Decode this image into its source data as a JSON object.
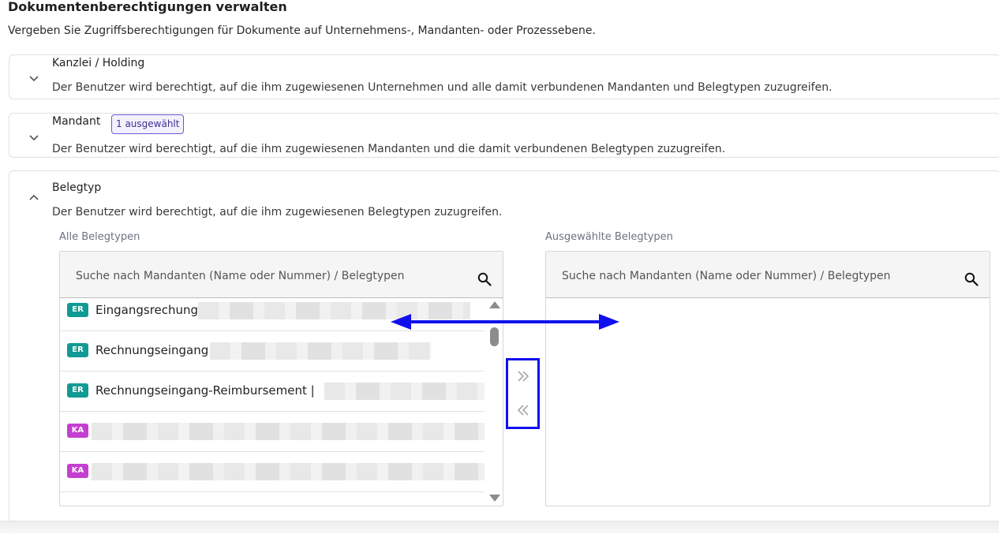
{
  "page": {
    "title": "Dokumentenberechtigungen verwalten",
    "subtitle": "Vergeben Sie Zugriffsberechtigungen für Dokumente auf Unternehmens-, Mandanten- oder Prozessebene."
  },
  "sections": [
    {
      "title": "Kanzlei / Holding",
      "description": "Der Benutzer wird berechtigt, auf die ihm zugewiesenen Unternehmen und alle damit verbundenen Mandanten und Belegtypen zuzugreifen.",
      "expanded": false
    },
    {
      "title": "Mandant",
      "badge": "1 ausgewählt",
      "description": "Der Benutzer wird berechtigt, auf die ihm zugewiesenen Mandanten und die damit verbundenen Belegtypen zuzugreifen.",
      "expanded": false
    },
    {
      "title": "Belegtyp",
      "description": "Der Benutzer wird berechtigt, auf die ihm zugewiesenen Belegtypen zuzugreifen.",
      "expanded": true
    }
  ],
  "belegtyp": {
    "all_label": "Alle Belegtypen",
    "selected_label": "Ausgewählte Belegtypen",
    "search_placeholder": "Suche nach Mandanten (Name oder Nummer) / Belegtypen",
    "items": [
      {
        "tag": "ER",
        "label": "Eingangsrechung"
      },
      {
        "tag": "ER",
        "label": "Rechnungseingang"
      },
      {
        "tag": "ER",
        "label": "Rechnungseingang-Reimbursement |"
      },
      {
        "tag": "KA",
        "label": ""
      },
      {
        "tag": "KA",
        "label": ""
      }
    ],
    "selected_items": [],
    "move_right": "»",
    "move_left": "«"
  },
  "colors": {
    "tag_er": "#119a94",
    "tag_ka": "#c43fcf",
    "annotation_blue": "#1010ee",
    "badge_border": "#6a5acd"
  },
  "icons": {
    "collapsed": "chevron-down-icon",
    "expanded": "chevron-up-icon",
    "search": "search-icon"
  }
}
